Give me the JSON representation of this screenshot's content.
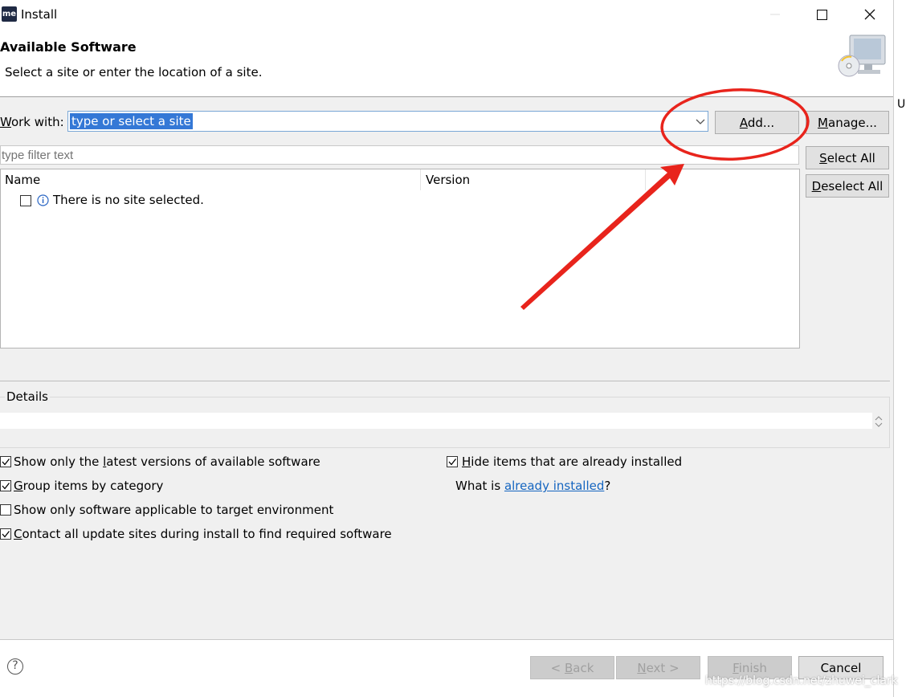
{
  "window": {
    "icon_text": "me",
    "title": "Install"
  },
  "header": {
    "title": "Available Software",
    "description": "Select a site or enter the location of a site."
  },
  "work_with": {
    "label_first": "W",
    "label_rest": "ork with:",
    "value": "type or select a site",
    "add_label_first": "A",
    "add_label_rest": "dd...",
    "manage_label_first": "M",
    "manage_label_rest": "anage..."
  },
  "filter": {
    "placeholder": "type filter text"
  },
  "side_buttons": {
    "select_all_first": "S",
    "select_all_rest": "elect All",
    "deselect_all_first": "D",
    "deselect_all_rest": "eselect All"
  },
  "table": {
    "columns": [
      "Name",
      "Version"
    ],
    "rows": [
      {
        "text": "There is no site selected.",
        "checked": false
      }
    ]
  },
  "details": {
    "label": "Details"
  },
  "options": {
    "latest_pre": "Show only the ",
    "latest_key": "l",
    "latest_post": "atest versions of available software",
    "group_key": "G",
    "group_post": "roup items by category",
    "target": "Show only software applicable to target environment",
    "contact_key": "C",
    "contact_post": "ontact all update sites during install to find required software",
    "hide_key": "H",
    "hide_post": "ide items that are already installed",
    "what_is": "What is ",
    "already_installed": "already installed",
    "question": "?"
  },
  "option_states": {
    "latest": true,
    "group": true,
    "target": false,
    "contact": true,
    "hide": true
  },
  "footer": {
    "back_pre": "< ",
    "back_key": "B",
    "back_post": "ack",
    "next_key": "N",
    "next_post": "ext >",
    "finish_key": "F",
    "finish_post": "inish",
    "cancel": "Cancel"
  },
  "watermark": "https://blog.csdn.net/zhuwei_clark",
  "colors": {
    "annotation": "#e8241c",
    "selection": "#3478d6",
    "link": "#1565c0"
  }
}
